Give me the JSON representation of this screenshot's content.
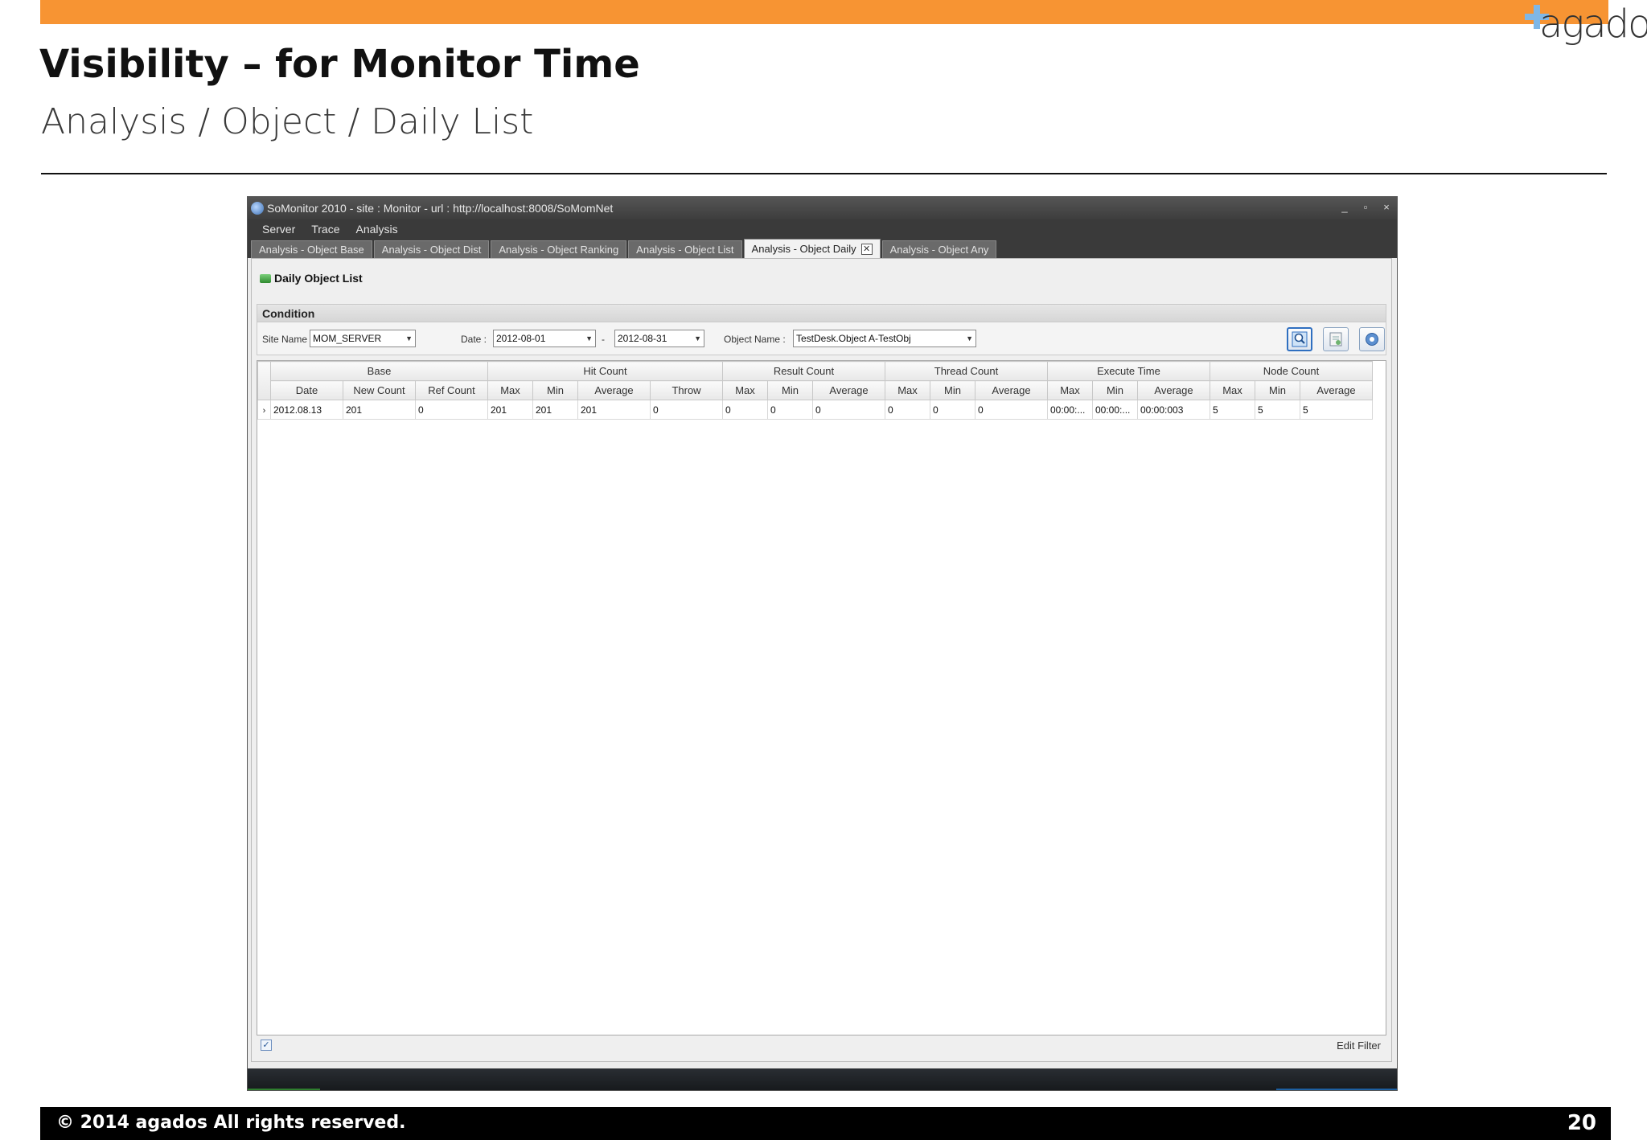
{
  "slide": {
    "title": "Visibility – for Monitor Time",
    "subtitle": "Analysis / Object / Daily List",
    "logo_text": "agados",
    "footer": "© 2014 agados All rights reserved.",
    "page_number": "20",
    "accent_color": "#f79433"
  },
  "app": {
    "title": "SoMonitor 2010 - site : Monitor - url : http://localhost:8008/SoMomNet",
    "window_buttons": [
      "_",
      "▫",
      "×"
    ],
    "menu": [
      "Server",
      "Trace",
      "Analysis"
    ],
    "tabs": [
      {
        "label": "Analysis - Object Base",
        "active": false
      },
      {
        "label": "Analysis - Object Dist",
        "active": false
      },
      {
        "label": "Analysis - Object Ranking",
        "active": false
      },
      {
        "label": "Analysis - Object List",
        "active": false
      },
      {
        "label": "Analysis - Object Daily",
        "active": true
      },
      {
        "label": "Analysis - Object Any",
        "active": false
      }
    ],
    "tab_close_glyph": "✕",
    "section_title": "Daily Object List",
    "condition": {
      "header": "Condition",
      "site_label": "Site Name :",
      "site_value": "MOM_SERVER",
      "date_label": "Date :",
      "date_from": "2012-08-01",
      "date_sep": "-",
      "date_to": "2012-08-31",
      "object_label": "Object Name :",
      "object_value": "TestDesk.Object A-TestObj",
      "buttons": [
        "search-icon",
        "export-icon",
        "help-icon"
      ]
    },
    "grid": {
      "groups": [
        "Base",
        "Hit Count",
        "Result Count",
        "Thread Count",
        "Execute Time",
        "Node Count"
      ],
      "columns": [
        "Date",
        "New Count",
        "Ref Count",
        "Max",
        "Min",
        "Average",
        "Throw",
        "Max",
        "Min",
        "Average",
        "Max",
        "Min",
        "Average",
        "Max",
        "Min",
        "Average",
        "Max",
        "Min",
        "Average"
      ],
      "rows": [
        [
          "2012.08.13",
          "201",
          "0",
          "201",
          "201",
          "201",
          "0",
          "0",
          "0",
          "0",
          "0",
          "0",
          "0",
          "00:00:...",
          "00:00:...",
          "00:00:003",
          "5",
          "5",
          "5"
        ]
      ],
      "row_indicator": "›"
    },
    "status": {
      "check_glyph": "✓",
      "edit_filter": "Edit Filter"
    }
  }
}
